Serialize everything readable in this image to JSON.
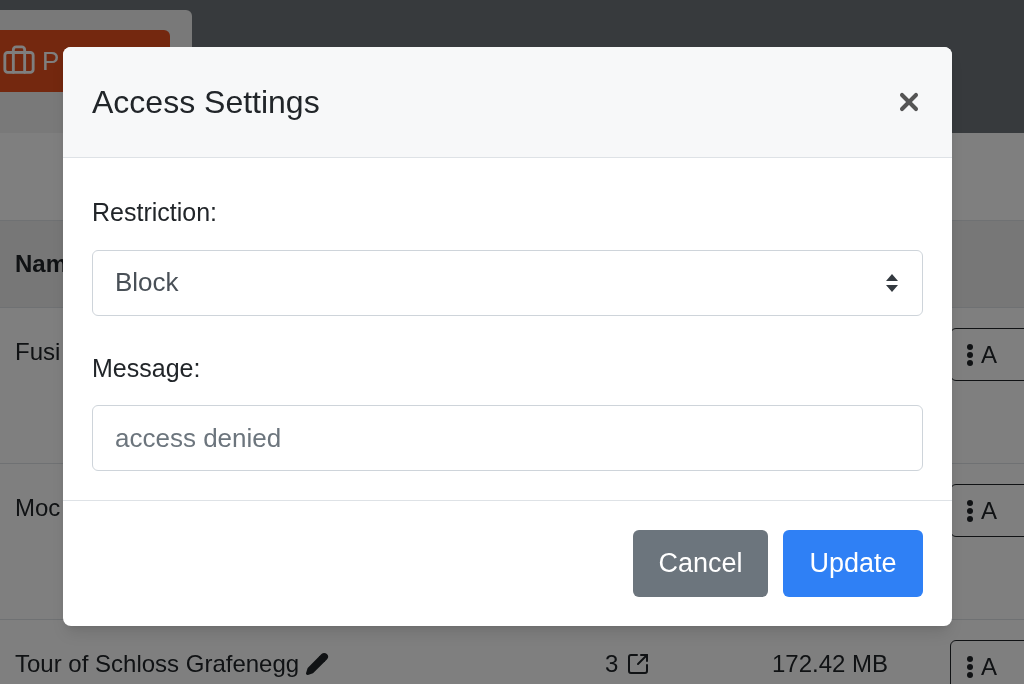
{
  "background": {
    "toolbar_button": {
      "label": "P"
    },
    "table": {
      "columns": [
        "Nam"
      ],
      "rows": [
        {
          "name": "Fusi",
          "action": "A"
        },
        {
          "name": "Moc",
          "action": "A"
        },
        {
          "name": "Tour of Schloss Grafenegg",
          "count": "3",
          "size": "172.42 MB",
          "action": "A"
        }
      ]
    }
  },
  "dialog": {
    "title": "Access Settings",
    "fields": [
      {
        "kind": "select",
        "label": "Restriction:",
        "value": "Block"
      },
      {
        "kind": "text",
        "label": "Message:",
        "placeholder": "access denied"
      }
    ],
    "buttons": [
      {
        "kind": "secondary",
        "label": "Cancel"
      },
      {
        "kind": "primary",
        "label": "Update"
      }
    ]
  }
}
